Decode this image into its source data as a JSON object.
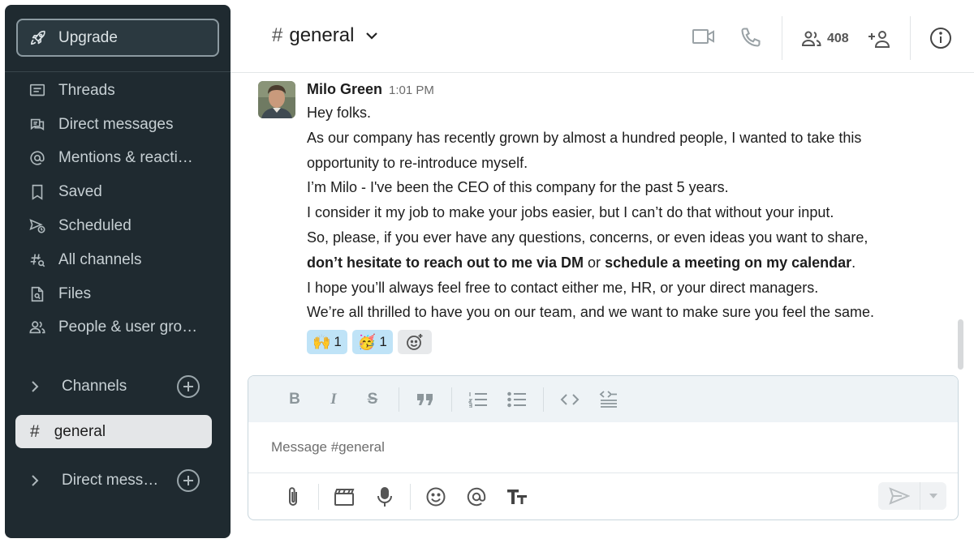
{
  "sidebar": {
    "upgrade_label": "Upgrade",
    "items": [
      {
        "label": "Threads",
        "icon": "threads-icon"
      },
      {
        "label": "Direct messages",
        "icon": "direct-messages-icon"
      },
      {
        "label": "Mentions & reacti…",
        "icon": "at-icon"
      },
      {
        "label": "Saved",
        "icon": "bookmark-icon"
      },
      {
        "label": "Scheduled",
        "icon": "scheduled-send-icon"
      },
      {
        "label": "All channels",
        "icon": "channel-search-icon"
      },
      {
        "label": "Files",
        "icon": "file-search-icon"
      },
      {
        "label": "People & user gro…",
        "icon": "people-icon"
      }
    ],
    "channels_label": "Channels",
    "active_channel": "general",
    "direct_label": "Direct mess…"
  },
  "header": {
    "channel_hash": "#",
    "channel_name": "general",
    "member_count": "408"
  },
  "message": {
    "author": "Milo Green",
    "time": "1:01 PM",
    "line1": "Hey folks.",
    "line2": "As our company has recently grown by almost a hundred people, I wanted to take this",
    "line3": "opportunity to re-introduce myself.",
    "line4": "I’m Milo - I've been the CEO of this company for the past 5 years.",
    "line5": "I consider it my job to make your jobs easier, but I can’t do that without your input.",
    "line6": "So, please, if you ever have any questions, concerns, or even ideas you want to share,",
    "line7_bold1": "don’t hesitate to reach out to me via DM",
    "line7_mid": " or ",
    "line7_bold2": "schedule a meeting on my calendar",
    "line7_end": ".",
    "line8": "I hope you’ll always feel free to contact either me, HR, or your direct managers.",
    "line9": "We’re all thrilled to have you on our team, and we want to make sure you feel the same.",
    "reactions": [
      {
        "emoji": "🙌",
        "count": "1"
      },
      {
        "emoji": "🥳",
        "count": "1"
      }
    ]
  },
  "composer": {
    "placeholder": "Message #general"
  },
  "colors": {
    "sidebar_bg": "#1f2a30",
    "reaction_bg": "#bfe3f7",
    "active_channel_bg": "#e4e6e8"
  }
}
